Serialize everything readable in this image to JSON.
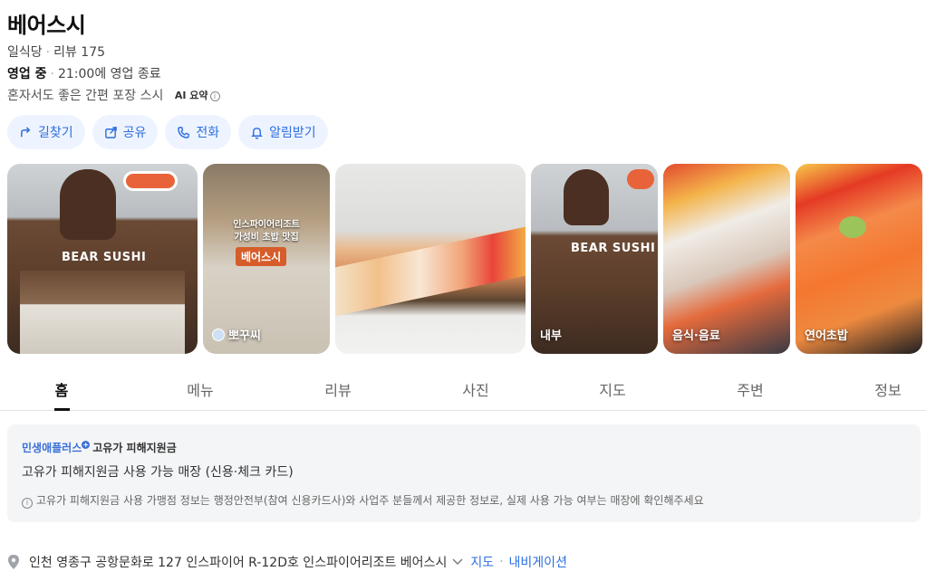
{
  "place": {
    "name": "베어스시",
    "category": "일식당",
    "reviews": "리뷰 175",
    "status": "영업 중",
    "closing": "21:00에 영업 종료",
    "summary": "혼자서도 좋은 간편 포장 스시",
    "ai_badge": "AI 요약",
    "info_glyph": "i"
  },
  "actions": [
    {
      "label": "길찾기",
      "icon": "directions-icon"
    },
    {
      "label": "공유",
      "icon": "share-icon"
    },
    {
      "label": "전화",
      "icon": "phone-icon"
    },
    {
      "label": "알림받기",
      "icon": "bell-icon"
    }
  ],
  "photos": {
    "sign_text": "BEAR SUSHI",
    "p2_overlay_line1": "인스파이어리조트",
    "p2_overlay_line2": "가성비 초밥 맛집",
    "p2_tag": "베어스시",
    "captions": [
      "뽀꾸씨",
      "내부",
      "음식·음료",
      "연어초밥"
    ]
  },
  "tabs": [
    "홈",
    "메뉴",
    "리뷰",
    "사진",
    "지도",
    "주변",
    "정보"
  ],
  "notice": {
    "brand": "민생애플러스",
    "plus": "+",
    "title": "고유가 피해지원금",
    "body": "고유가 피해지원금 사용 가능 매장 (신용·체크 카드)",
    "footer": "고유가 피해지원금 사용 가맹점 정보는 행정안전부(참여 신용카드사)와 사업주 분들께서 제공한 정보로, 실제 사용 가능 여부는 매장에 확인해주세요"
  },
  "address": {
    "text": "인천 영종구 공항문화로 127 인스파이어 R-12D호 인스파이어리조트 베어스시",
    "map_link": "지도",
    "nav_link": "내비게이션"
  },
  "colors": {
    "accent": "#2c6ee0",
    "button_bg": "#eef4ff",
    "notice_bg": "#f4f5f7"
  }
}
